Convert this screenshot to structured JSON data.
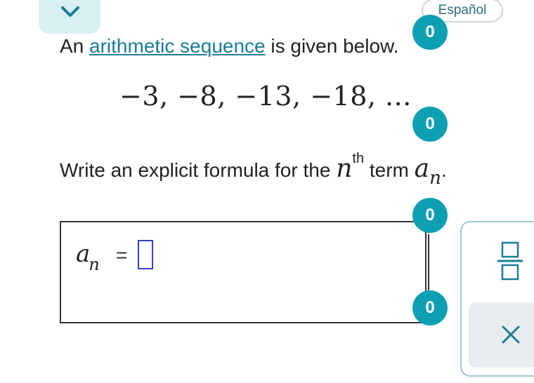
{
  "header": {
    "collapse_icon": "chevron-down-icon",
    "language_label": "Español"
  },
  "badges": {
    "intro_count": "0",
    "sequence_count": "0",
    "answer_top_count": "0",
    "answer_bottom_count": "0"
  },
  "question": {
    "intro_prefix": "An ",
    "intro_link": "arithmetic sequence",
    "intro_suffix": " is given below.",
    "sequence": "−3, −8, −13, −18, ...",
    "prompt_prefix": "Write an explicit formula for the ",
    "prompt_var_n": "n",
    "prompt_sup": "th",
    "prompt_middle": " term ",
    "prompt_var_a": "a",
    "prompt_sub": "n",
    "prompt_suffix": "."
  },
  "answer": {
    "lhs_var": "a",
    "lhs_sub": "n",
    "equals": "="
  },
  "tools": {
    "fraction_icon": "fraction-icon",
    "clear_icon": "close-icon"
  },
  "colors": {
    "accent": "#0f9fb2",
    "link": "#1a7d94",
    "cursor": "#3340c8",
    "tab_bg": "#d6f0f4"
  }
}
